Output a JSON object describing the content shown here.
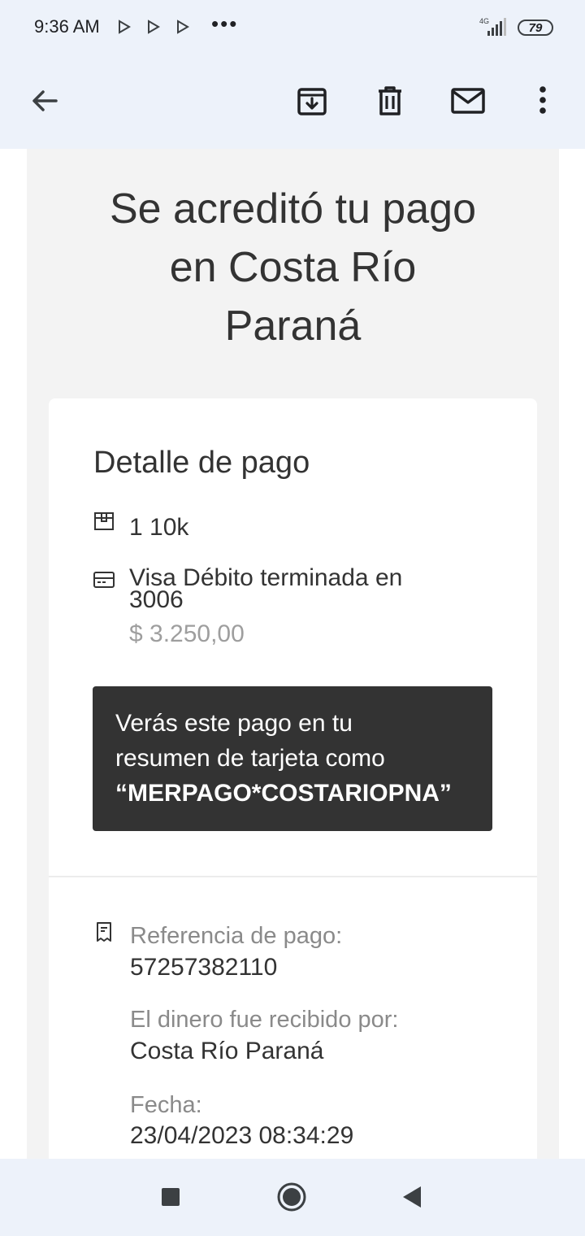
{
  "status_bar": {
    "time": "9:36 AM",
    "dots": "•••",
    "network": "4G",
    "battery": "79"
  },
  "toolbar": {
    "icons": [
      "back-arrow-icon",
      "archive-icon",
      "delete-icon",
      "mail-icon",
      "more-vert-icon"
    ]
  },
  "email": {
    "headline_lines": [
      "Se acreditó tu pago",
      "en Costa Río",
      "Paraná"
    ],
    "detail_title": "Detalle de pago",
    "item": "1 10k",
    "card_line1": "Visa Débito terminada en",
    "card_line2": "3006",
    "amount": "$ 3.250,00",
    "statement_line1": "Verás este pago en tu",
    "statement_line2": "resumen de tarjeta como",
    "statement_code": "“MERPAGO*COSTARIOPNA”",
    "reference_label": "Referencia de pago:",
    "reference_value": "57257382110",
    "receiver_label": "El dinero fue recibido por:",
    "receiver_value": "Costa Río Paraná",
    "date_label": "Fecha:",
    "date_value": "23/04/2023 08:34:29"
  },
  "nav_bar": {
    "icons": [
      "recents-square-icon",
      "home-circle-icon",
      "back-triangle-icon"
    ]
  }
}
